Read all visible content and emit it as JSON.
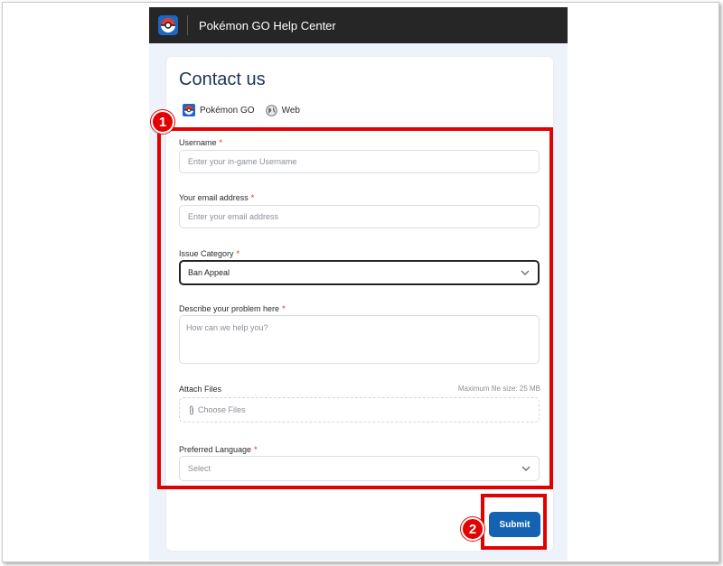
{
  "header": {
    "title": "Pokémon GO Help Center"
  },
  "card": {
    "title": "Contact us",
    "tags": [
      {
        "label": "Pokémon GO",
        "icon": "pokeball-icon"
      },
      {
        "label": "Web",
        "icon": "globe-icon"
      }
    ]
  },
  "form": {
    "username": {
      "label": "Username",
      "required": "*",
      "placeholder": "Enter your in-game Username"
    },
    "email": {
      "label": "Your email address",
      "required": "*",
      "placeholder": "Enter your email address"
    },
    "category": {
      "label": "Issue Category",
      "required": "*",
      "value": "Ban Appeal"
    },
    "problem": {
      "label": "Describe your problem here",
      "required": "*",
      "placeholder": "How can we help you?"
    },
    "attach": {
      "label": "Attach Files",
      "max_size": "Maximum file size: 25 MB",
      "button": "Choose Files"
    },
    "language": {
      "label": "Preferred Language",
      "required": "*",
      "value": "Select"
    },
    "submit_label": "Submit"
  },
  "annotations": {
    "badge1": "1",
    "badge2": "2"
  },
  "colors": {
    "accent": "#1562b3",
    "highlight": "#e30000",
    "header_bg": "#262626"
  }
}
